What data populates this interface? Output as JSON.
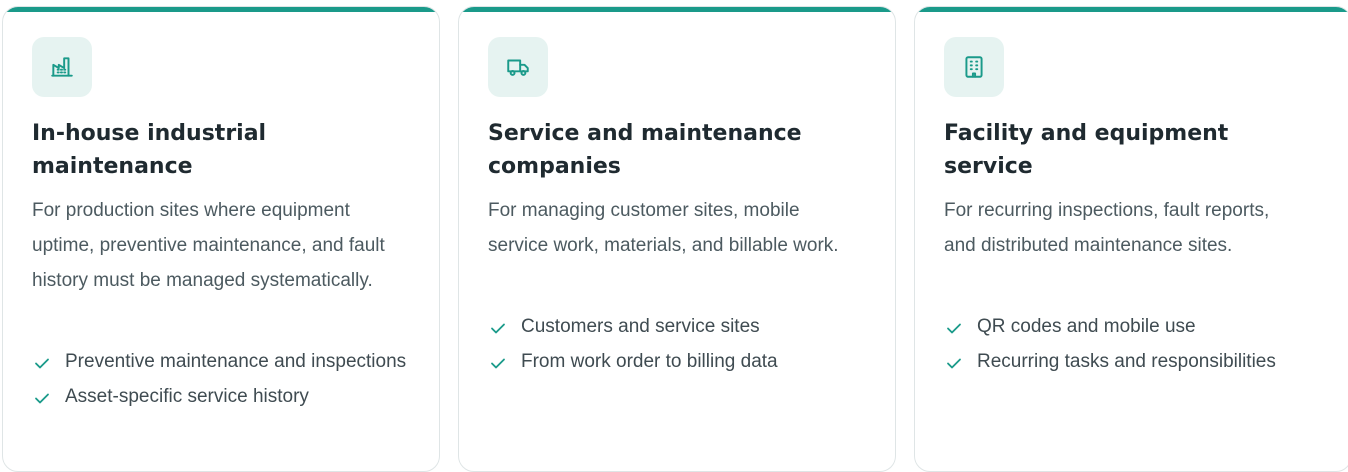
{
  "accent_color": "#1a9a8a",
  "icon_bg_color": "#e6f3f1",
  "cards": [
    {
      "icon": "factory-icon",
      "title": "In-house industrial maintenance",
      "description": "For production sites where equipment uptime, preventive maintenance, and fault history must be managed systematically.",
      "features": [
        "Preventive maintenance and inspections",
        "Asset-specific service history"
      ]
    },
    {
      "icon": "truck-icon",
      "title": "Service and maintenance companies",
      "description": "For managing customer sites, mobile service work, materials, and billable work.",
      "features": [
        "Customers and service sites",
        "From work order to billing data"
      ]
    },
    {
      "icon": "building-icon",
      "title": "Facility and equipment service",
      "description": "For recurring inspections, fault reports, and distributed maintenance sites.",
      "features": [
        "QR codes and mobile use",
        "Recurring tasks and responsibilities"
      ]
    }
  ]
}
